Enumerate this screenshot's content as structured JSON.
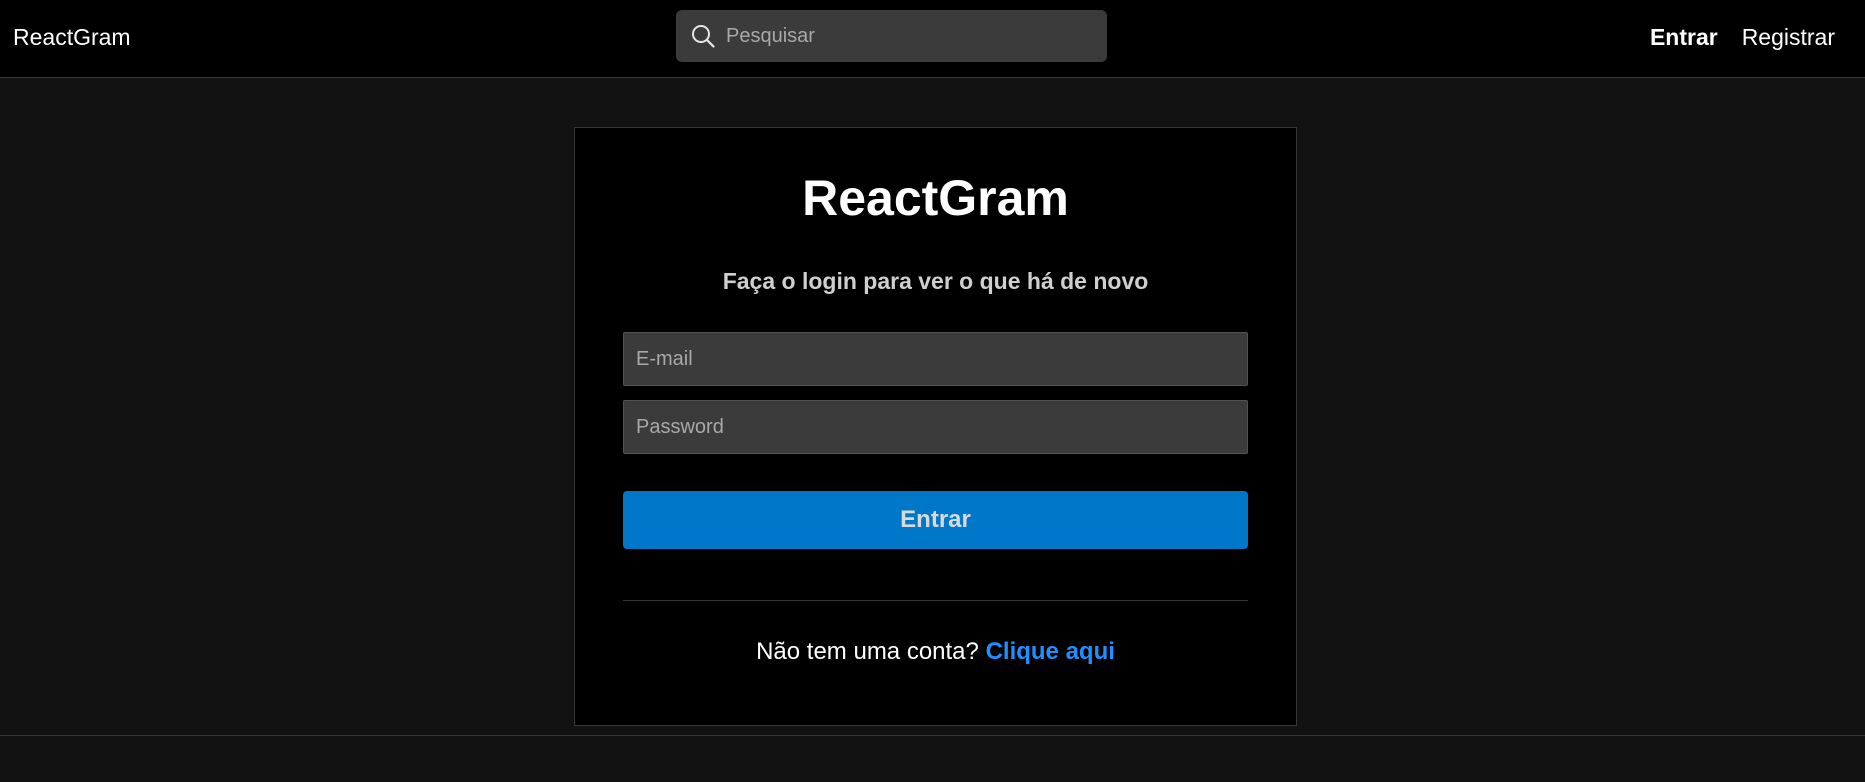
{
  "navbar": {
    "brand": "ReactGram",
    "search": {
      "placeholder": "Pesquisar",
      "value": "",
      "icon": "search-icon"
    },
    "links": {
      "login": "Entrar",
      "register": "Registrar"
    }
  },
  "login_card": {
    "title": "ReactGram",
    "subtitle": "Faça o login para ver o que há de novo",
    "email": {
      "placeholder": "E-mail",
      "value": ""
    },
    "password": {
      "placeholder": "Password",
      "value": ""
    },
    "submit_label": "Entrar",
    "signup_prompt": "Não tem uma conta?",
    "signup_link": "Clique aqui"
  },
  "colors": {
    "background": "#121212",
    "navbar": "#000000",
    "card": "#000000",
    "input": "#3b3b3b",
    "primary_button": "#0077c8",
    "link": "#1e90ff"
  }
}
